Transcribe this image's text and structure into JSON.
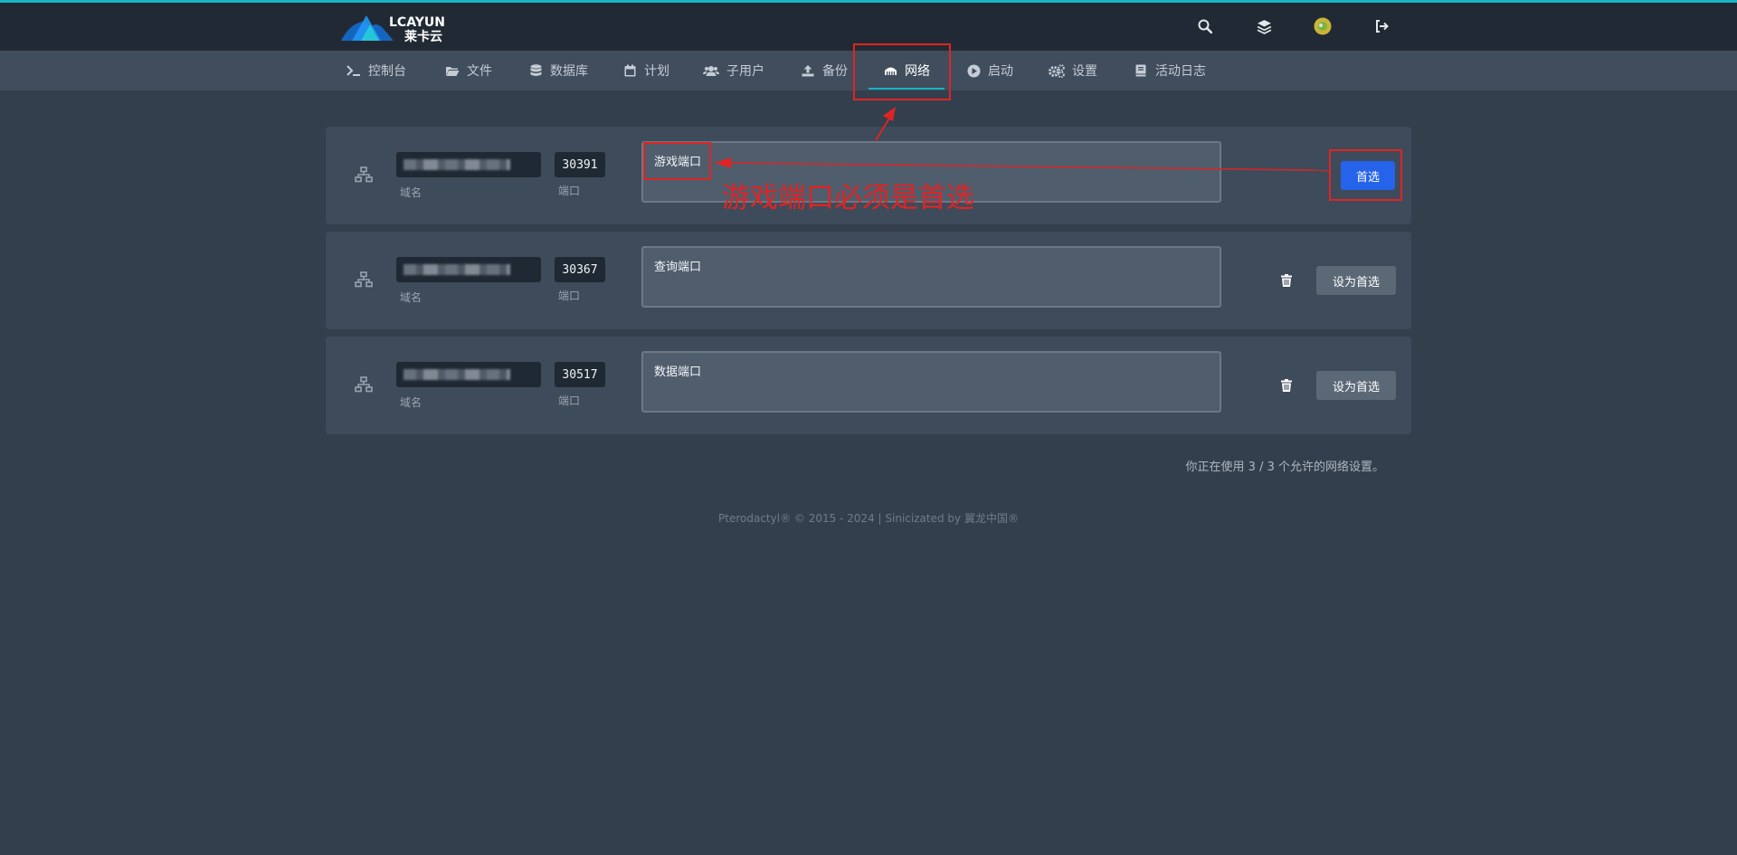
{
  "brand": {
    "logo_text": "LCAYUN",
    "logo_subtext": "莱卡云",
    "logo_color": "#1e88e5"
  },
  "topbar": {
    "icons": [
      "search-icon",
      "layers-icon",
      "avatar",
      "logout-icon"
    ]
  },
  "nav": {
    "items": [
      {
        "label": "控制台",
        "icon": "terminal-icon"
      },
      {
        "label": "文件",
        "icon": "folder-icon"
      },
      {
        "label": "数据库",
        "icon": "database-icon"
      },
      {
        "label": "计划",
        "icon": "calendar-icon"
      },
      {
        "label": "子用户",
        "icon": "users-icon"
      },
      {
        "label": "备份",
        "icon": "upload-icon"
      },
      {
        "label": "网络",
        "icon": "network-icon",
        "active": true
      },
      {
        "label": "启动",
        "icon": "play-icon"
      },
      {
        "label": "设置",
        "icon": "cogs-icon"
      },
      {
        "label": "活动日志",
        "icon": "book-icon"
      }
    ]
  },
  "allocations": {
    "domain_label": "域名",
    "port_label": "端口",
    "rows": [
      {
        "port": "30391",
        "notes": "游戏端口",
        "primary": true,
        "primary_label": "首选"
      },
      {
        "port": "30367",
        "notes": "查询端口",
        "primary": false,
        "make_primary_label": "设为首选"
      },
      {
        "port": "30517",
        "notes": "数据端口",
        "primary": false,
        "make_primary_label": "设为首选"
      }
    ],
    "usage_text": "你正在使用 3 / 3 个允许的网络设置。"
  },
  "annotation": {
    "text": "游戏端口必须是首选",
    "color": "#e02424"
  },
  "footer": {
    "text": "Pterodactyl® © 2015 - 2024 | Sinicizated by 翼龙中国®"
  },
  "colors": {
    "accent": "#17b3c4",
    "primary_button": "#2563eb",
    "background": "#333f4d"
  }
}
